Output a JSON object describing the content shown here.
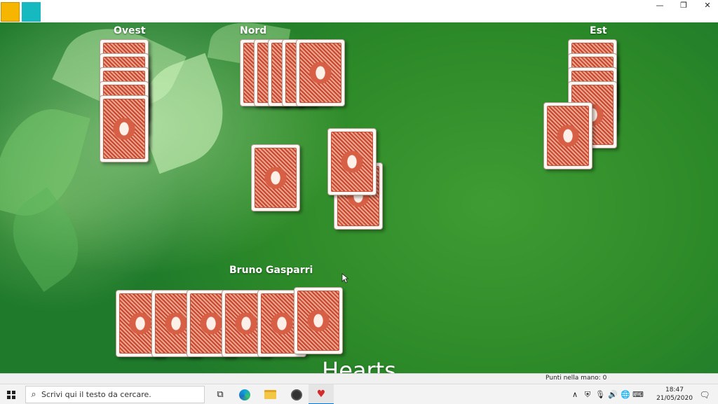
{
  "window": {
    "minimize_glyph": "—",
    "maximize_glyph": "❐",
    "close_glyph": "✕"
  },
  "players": {
    "west": "Ovest",
    "north": "Nord",
    "east": "Est",
    "south": "Bruno Gasparri"
  },
  "game_title": "Hearts",
  "status": {
    "points_in_hand": "Punti nella mano: 0"
  },
  "taskbar": {
    "search_placeholder": "Scrivi qui il testo da cercare.",
    "search_icon": "⌕",
    "taskview_icon": "⧉",
    "hearts_icon": "♥",
    "tray": {
      "chevron": "∧",
      "shield": "⛨",
      "mic": "🎙",
      "volume": "🔊",
      "network": "🌐",
      "keyboard": "⌨"
    },
    "time": "18:47",
    "date": "21/05/2020",
    "notification_icon": "🗨"
  },
  "cards": {
    "west": 5,
    "north": 5,
    "east": 5,
    "south": 6,
    "trick": 3
  },
  "colors": {
    "table_green": "#2d8a28",
    "card_red": "#c9472f"
  }
}
